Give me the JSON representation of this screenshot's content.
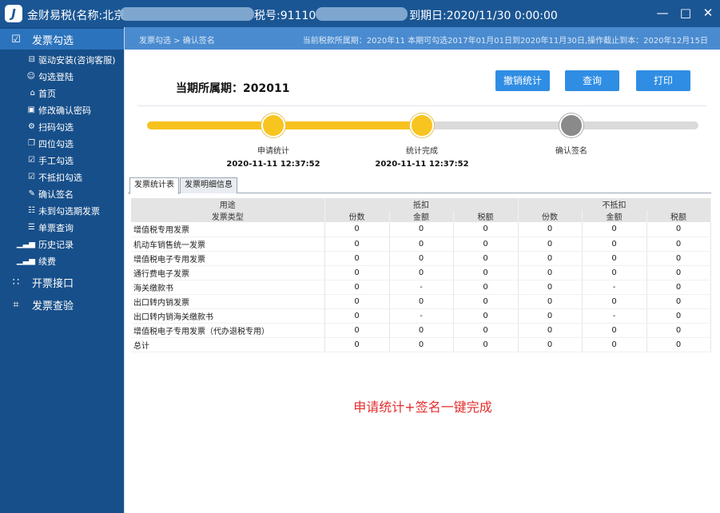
{
  "window": {
    "title": "金财易税(名称:北京",
    "tax_no_label": "税号:91110",
    "expire": "到期日:2020/11/30 0:00:00"
  },
  "sidebar": {
    "main_items": [
      {
        "label": "发票勾选",
        "icon": "checkbox-icon"
      },
      {
        "label": "开票接口",
        "icon": "grid-icon"
      },
      {
        "label": "发票查验",
        "icon": "scan-icon"
      }
    ],
    "sub_items": [
      {
        "label": "驱动安装(咨询客服)",
        "icon": "install-icon"
      },
      {
        "label": "勾选登陆",
        "icon": "user-icon"
      },
      {
        "label": "首页",
        "icon": "home-icon"
      },
      {
        "label": "修改确认密码",
        "icon": "lock-icon"
      },
      {
        "label": "扫码勾选",
        "icon": "gear-icon"
      },
      {
        "label": "四位勾选",
        "icon": "copy-icon"
      },
      {
        "label": "手工勾选",
        "icon": "check-icon"
      },
      {
        "label": "不抵扣勾选",
        "icon": "check-icon"
      },
      {
        "label": "确认签名",
        "icon": "signature-icon"
      },
      {
        "label": "未到勾选期发票",
        "icon": "document-icon"
      },
      {
        "label": "单票查询",
        "icon": "search-doc-icon"
      },
      {
        "label": "历史记录",
        "icon": "bar-chart-icon"
      },
      {
        "label": "续费",
        "icon": "bar-chart-icon"
      }
    ]
  },
  "crumb": {
    "path": "发票勾选 > 确认签名",
    "note": "当前税款所属期：2020年11 本期可勾选2017年01月01日到2020年11月30日,操作截止到本：2020年12月15日"
  },
  "period": {
    "label": "当期所属期：",
    "value": "202011"
  },
  "buttons": {
    "revoke": "撤销统计",
    "query": "查询",
    "print": "打印"
  },
  "steps": [
    {
      "label": "申请统计",
      "time": "2020-11-11 12:37:52",
      "state": "done"
    },
    {
      "label": "统计完成",
      "time": "2020-11-11 12:37:52",
      "state": "done"
    },
    {
      "label": "确认签名",
      "time": "",
      "state": "todo"
    }
  ],
  "progress": 0.49,
  "tabs": [
    {
      "label": "发票统计表",
      "active": true
    },
    {
      "label": "发票明细信息",
      "active": false
    }
  ],
  "table": {
    "purpose_label": "用途",
    "type_label": "发票类型",
    "deduct_label": "抵扣",
    "nondeduct_label": "不抵扣",
    "sub_headers": [
      "份数",
      "金额",
      "税额",
      "份数",
      "金额",
      "税额"
    ],
    "rows": [
      {
        "name": "增值税专用发票",
        "cells": [
          "0",
          "0",
          "0",
          "0",
          "0",
          "0"
        ]
      },
      {
        "name": "机动车销售统一发票",
        "cells": [
          "0",
          "0",
          "0",
          "0",
          "0",
          "0"
        ]
      },
      {
        "name": "增值税电子专用发票",
        "cells": [
          "0",
          "0",
          "0",
          "0",
          "0",
          "0"
        ]
      },
      {
        "name": "通行费电子发票",
        "cells": [
          "0",
          "0",
          "0",
          "0",
          "0",
          "0"
        ]
      },
      {
        "name": "海关缴款书",
        "cells": [
          "0",
          "-",
          "0",
          "0",
          "-",
          "0"
        ]
      },
      {
        "name": "出口转内销发票",
        "cells": [
          "0",
          "0",
          "0",
          "0",
          "0",
          "0"
        ]
      },
      {
        "name": "出口转内销海关缴款书",
        "cells": [
          "0",
          "-",
          "0",
          "0",
          "-",
          "0"
        ]
      },
      {
        "name": "增值税电子专用发票（代办退税专用）",
        "cells": [
          "0",
          "0",
          "0",
          "0",
          "0",
          "0"
        ]
      },
      {
        "name": "总计",
        "cells": [
          "0",
          "0",
          "0",
          "0",
          "0",
          "0"
        ]
      }
    ]
  },
  "banner": "申请统计+签名一键完成",
  "colors": {
    "titlebar": "#1b5694",
    "sidebar": "#174f8a",
    "active_nav": "#2c73bd",
    "button": "#2f8de4",
    "progress": "#f7c21e",
    "banner": "#e52e2e"
  }
}
